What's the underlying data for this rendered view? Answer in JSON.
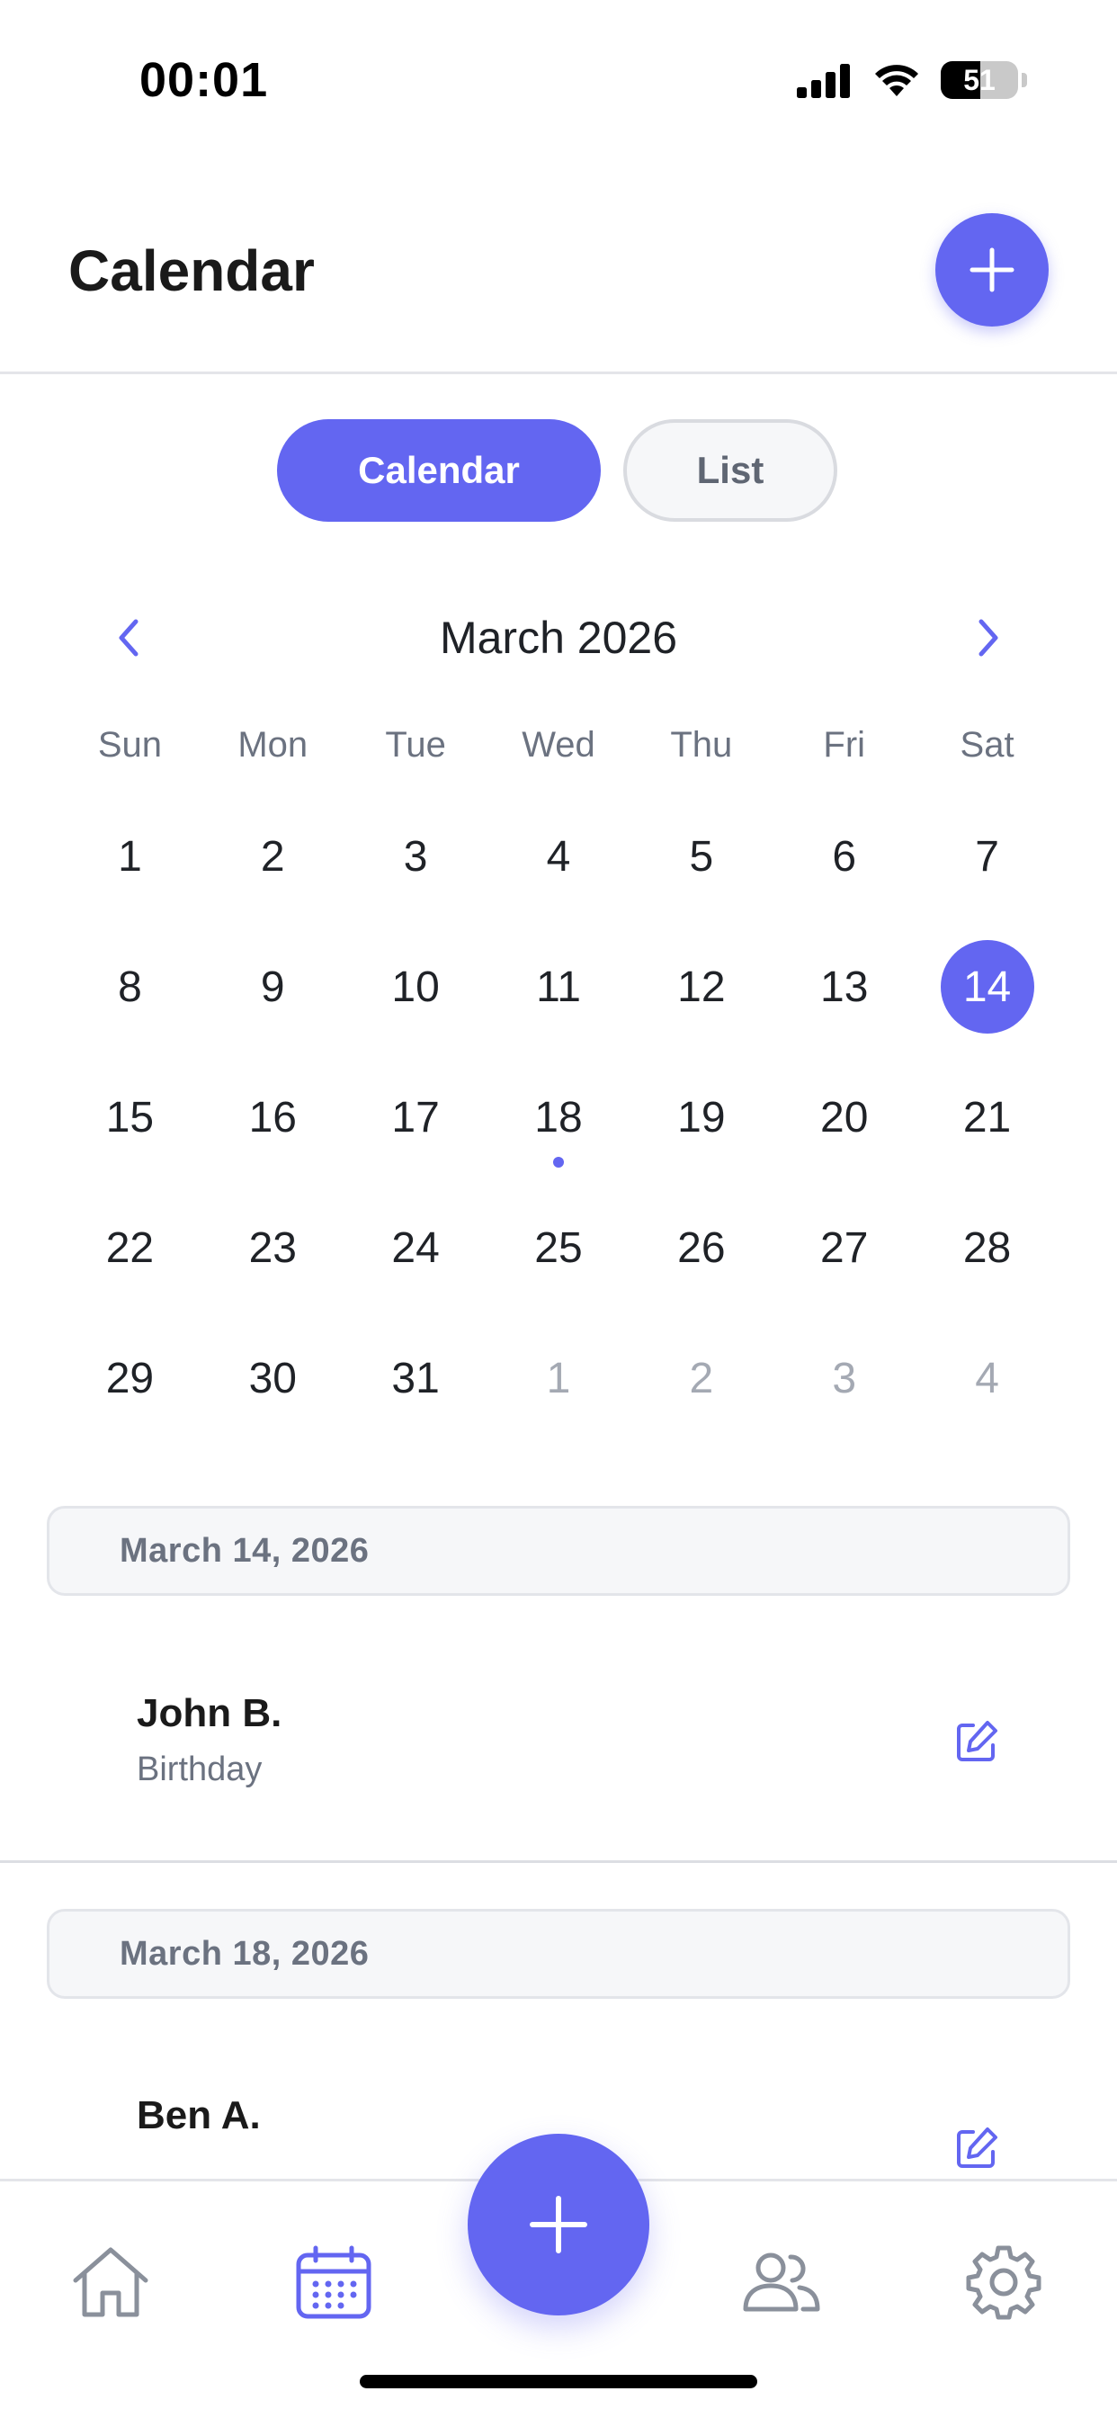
{
  "status_bar": {
    "time": "00:01",
    "battery": "51",
    "battery_level": 0.51
  },
  "header": {
    "title": "Calendar",
    "add_icon": "plus-icon"
  },
  "view_toggle": {
    "calendar_label": "Calendar",
    "list_label": "List",
    "active": "Calendar"
  },
  "calendar": {
    "month_label": "March 2026",
    "weekdays": [
      "Sun",
      "Mon",
      "Tue",
      "Wed",
      "Thu",
      "Fri",
      "Sat"
    ],
    "days": [
      {
        "n": "1"
      },
      {
        "n": "2"
      },
      {
        "n": "3"
      },
      {
        "n": "4"
      },
      {
        "n": "5"
      },
      {
        "n": "6"
      },
      {
        "n": "7"
      },
      {
        "n": "8"
      },
      {
        "n": "9"
      },
      {
        "n": "10"
      },
      {
        "n": "11"
      },
      {
        "n": "12"
      },
      {
        "n": "13"
      },
      {
        "n": "14",
        "selected": true
      },
      {
        "n": "15"
      },
      {
        "n": "16"
      },
      {
        "n": "17"
      },
      {
        "n": "18",
        "has_event": true
      },
      {
        "n": "19"
      },
      {
        "n": "20"
      },
      {
        "n": "21"
      },
      {
        "n": "22"
      },
      {
        "n": "23"
      },
      {
        "n": "24"
      },
      {
        "n": "25"
      },
      {
        "n": "26"
      },
      {
        "n": "27"
      },
      {
        "n": "28"
      },
      {
        "n": "29"
      },
      {
        "n": "30"
      },
      {
        "n": "31"
      },
      {
        "n": "1",
        "other_month": true
      },
      {
        "n": "2",
        "other_month": true
      },
      {
        "n": "3",
        "other_month": true
      },
      {
        "n": "4",
        "other_month": true
      }
    ]
  },
  "events": [
    {
      "date": "March 14, 2026",
      "name": "John B.",
      "type": "Birthday"
    },
    {
      "date": "March 18, 2026",
      "name": "Ben A.",
      "type": ""
    }
  ],
  "tab_bar": {
    "items": [
      "home-icon",
      "calendar-icon",
      "plus-icon",
      "people-icon",
      "gear-icon"
    ],
    "active": "calendar-icon"
  },
  "colors": {
    "accent": "#6366f1",
    "text_primary": "#1a1a1a",
    "text_muted": "#6b7280",
    "text_disabled": "#a4a9b3",
    "surface": "#f6f7f9",
    "border": "#e3e5ea"
  }
}
